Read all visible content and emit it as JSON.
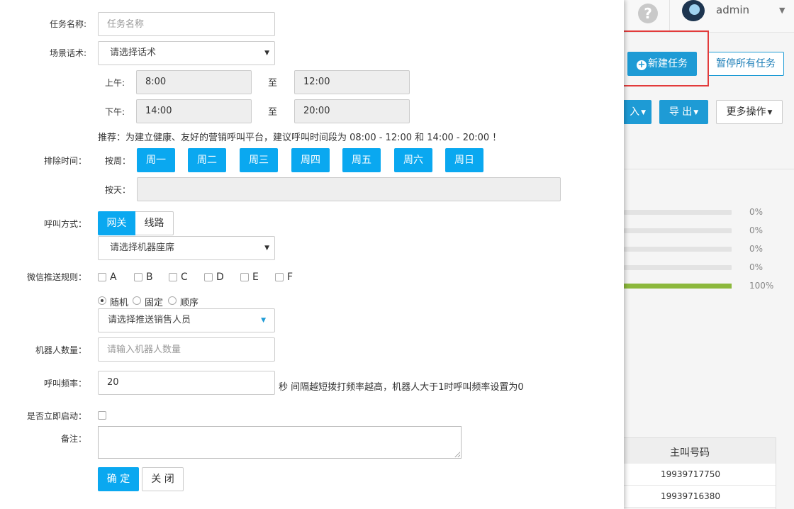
{
  "header": {
    "help_icon": "question-circle-icon",
    "help_glyph": "?",
    "user_name": "admin",
    "caret": "▼"
  },
  "toolbar": {
    "new_task_label": "新建任务",
    "pause_all_label": "暂停所有任务",
    "import_label": "入",
    "export_label": "导 出",
    "more_label": "更多操作",
    "caret": "▼"
  },
  "progress": [
    {
      "percent": 0,
      "label": "0%"
    },
    {
      "percent": 0,
      "label": "0%"
    },
    {
      "percent": 0,
      "label": "0%"
    },
    {
      "percent": 0,
      "label": "0%"
    },
    {
      "percent": 100,
      "label": "100%"
    }
  ],
  "table": {
    "header": "主叫号码",
    "rows": [
      "19939717750",
      "19939716380"
    ]
  },
  "form": {
    "task_name": {
      "label": "任务名称:",
      "placeholder": "任务名称"
    },
    "scene": {
      "label": "场景话术:",
      "selected": "请选择话术"
    },
    "time": {
      "am_label": "上午:",
      "am_start": "8:00",
      "am_end": "12:00",
      "pm_label": "下午:",
      "pm_start": "14:00",
      "pm_end": "20:00",
      "to": "至",
      "recommend": "推荐：为建立健康、友好的营销呼叫平台，建议呼叫时间段为 08:00 - 12:00 和 14:00 - 20:00 ！"
    },
    "exclude": {
      "label": "排除时间：",
      "week_label": "按周：",
      "days": [
        "周一",
        "周二",
        "周三",
        "周四",
        "周五",
        "周六",
        "周日"
      ],
      "day_label": "按天："
    },
    "call_mode": {
      "label": "呼叫方式：",
      "options": [
        "网关",
        "线路"
      ],
      "seat_selected": "请选择机器座席"
    },
    "wechat": {
      "label": "微信推送规则：",
      "checks": [
        "A",
        "B",
        "C",
        "D",
        "E",
        "F"
      ],
      "radios": [
        "随机",
        "固定",
        "顺序"
      ],
      "sales_selected": "请选择推送销售人员"
    },
    "robot_count": {
      "label": "机器人数量：",
      "placeholder": "请输入机器人数量"
    },
    "frequency": {
      "label": "呼叫频率：",
      "value": "20",
      "hint": "秒 间隔越短拨打频率越高，机器人大于1时呼叫频率设置为0"
    },
    "start_now": {
      "label": "是否立即启动："
    },
    "remark": {
      "label": "备注："
    },
    "ok_label": "确 定",
    "close_label": "关 闭"
  },
  "colors": {
    "primary": "#0aa8f0",
    "toolbar_blue": "#1e9bd5",
    "progress_green": "#8cb83c",
    "highlight_red": "#e23b3b"
  }
}
